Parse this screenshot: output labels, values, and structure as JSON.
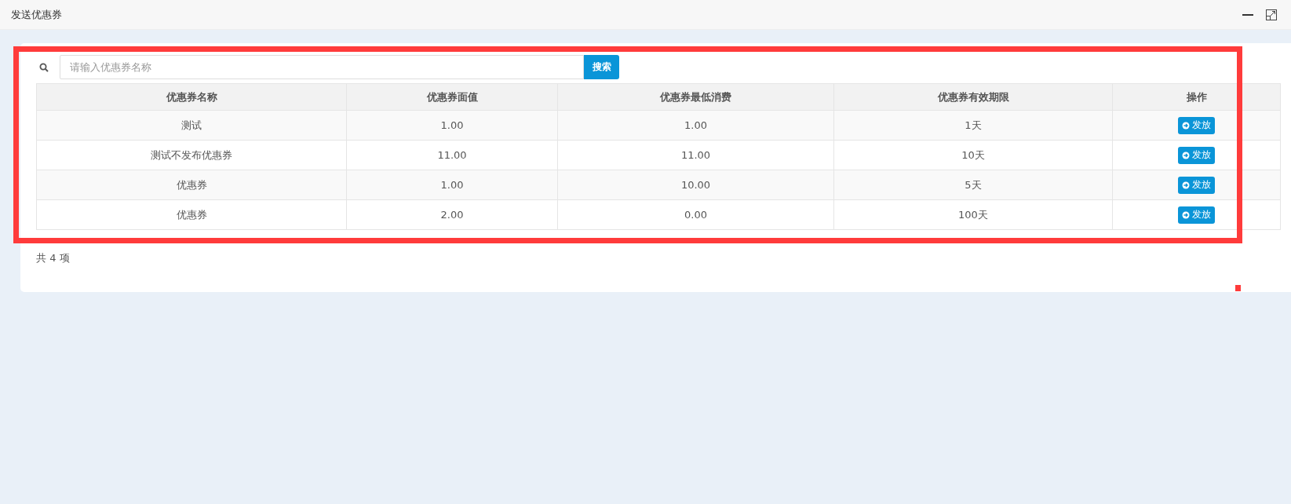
{
  "window": {
    "title": "发送优惠券"
  },
  "search": {
    "placeholder": "请输入优惠券名称",
    "button": "搜索"
  },
  "table": {
    "columns": [
      "优惠券名称",
      "优惠券面值",
      "优惠券最低消费",
      "优惠券有效期限",
      "操作"
    ],
    "rows": [
      {
        "cells": [
          "测试",
          "1.00",
          "1.00",
          "1天"
        ],
        "action": "发放"
      },
      {
        "cells": [
          "测试不发布优惠券",
          "11.00",
          "11.00",
          "10天"
        ],
        "action": "发放"
      },
      {
        "cells": [
          "优惠券",
          "1.00",
          "10.00",
          "5天"
        ],
        "action": "发放"
      },
      {
        "cells": [
          "优惠券",
          "2.00",
          "0.00",
          "100天"
        ],
        "action": "发放"
      }
    ]
  },
  "footer": {
    "total": "共 4 项"
  }
}
